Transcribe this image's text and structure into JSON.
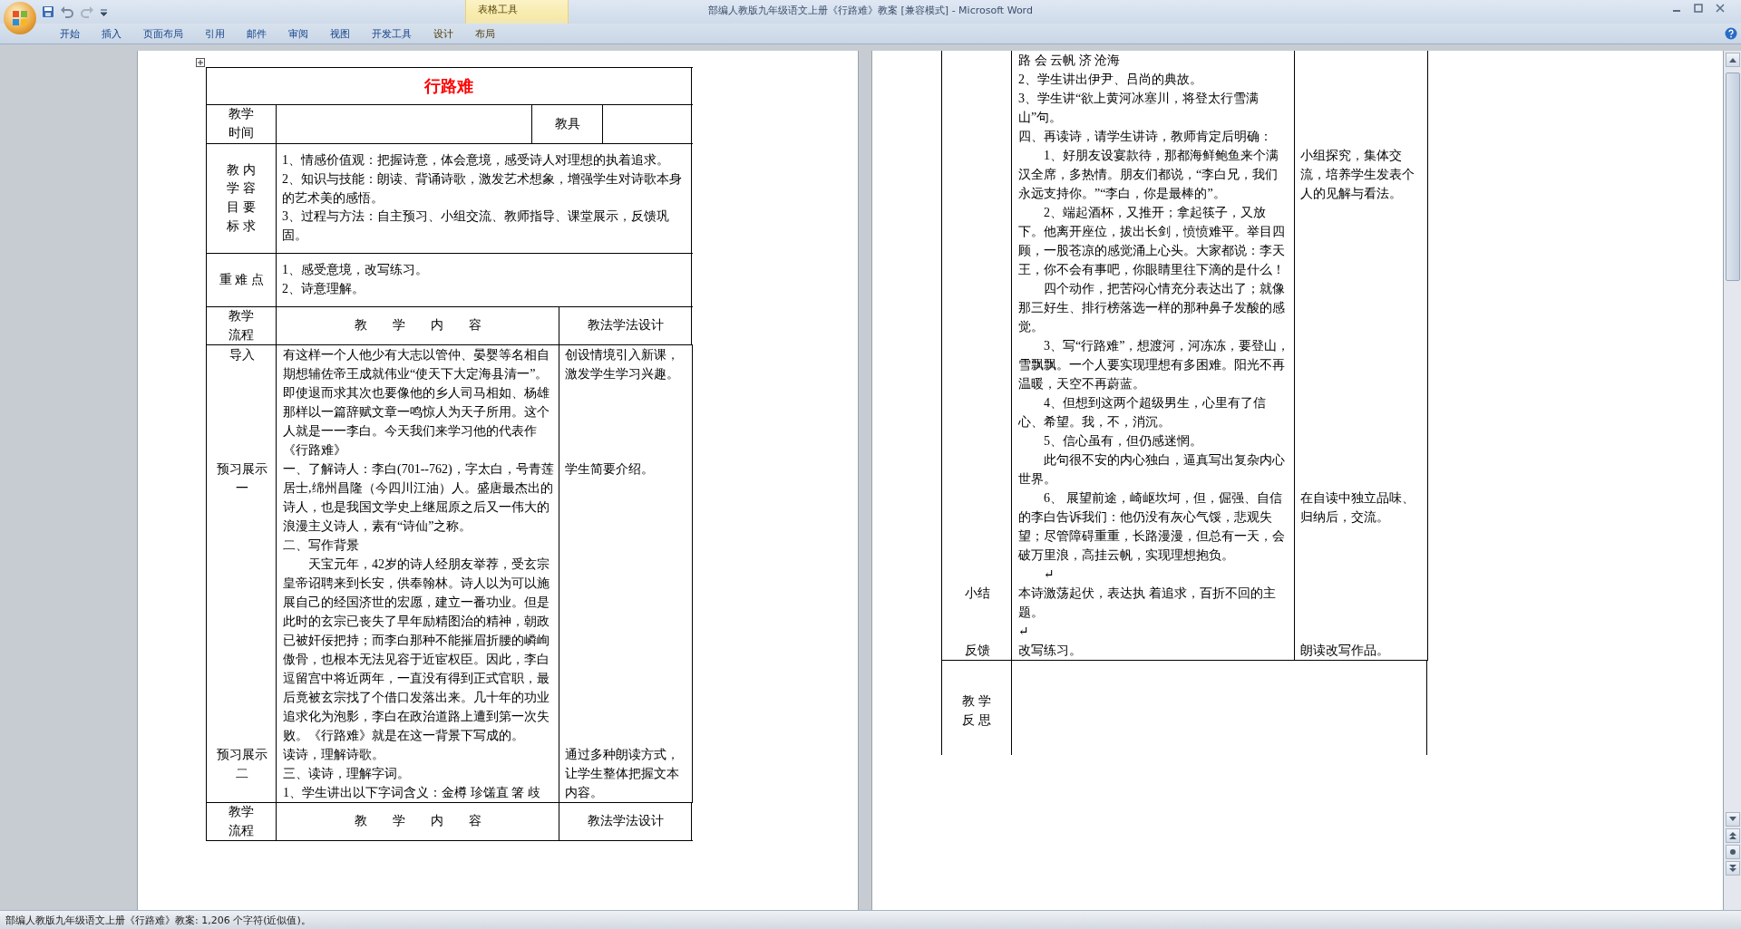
{
  "window": {
    "title": "部编人教版九年级语文上册《行路难》教案 [兼容模式] - Microsoft Word"
  },
  "ribbon": {
    "context_group": "表格工具",
    "tabs": [
      {
        "label": "开始",
        "selected": false,
        "contextual": false
      },
      {
        "label": "插入",
        "selected": false,
        "contextual": false
      },
      {
        "label": "页面布局",
        "selected": false,
        "contextual": false
      },
      {
        "label": "引用",
        "selected": false,
        "contextual": false
      },
      {
        "label": "邮件",
        "selected": false,
        "contextual": false
      },
      {
        "label": "审阅",
        "selected": false,
        "contextual": false
      },
      {
        "label": "视图",
        "selected": false,
        "contextual": false
      },
      {
        "label": "开发工具",
        "selected": false,
        "contextual": false
      },
      {
        "label": "设计",
        "selected": false,
        "contextual": true
      },
      {
        "label": "布局",
        "selected": false,
        "contextual": true
      }
    ]
  },
  "pages": [
    {
      "rows": [
        {
          "kind": "title",
          "text": "行路难"
        },
        {
          "kind": "time",
          "label": [
            "教学",
            "时间"
          ],
          "tool_label": "教具"
        },
        {
          "kind": "goals",
          "label": [
            "教 内",
            "学 容",
            "目 要",
            "标 求"
          ],
          "items": [
            "1、情感价值观：把握诗意，体会意境，感受诗人对理想的执着追求。",
            "2、知识与技能：朗读、背诵诗歌，激发艺术想象，增强学生对诗歌本身的艺术美的感悟。",
            "3、过程与方法：自主预习、小组交流、教师指导、课堂展示，反馈巩固。"
          ]
        },
        {
          "kind": "key",
          "label": [
            "重 难 点"
          ],
          "items": [
            "1、感受意境，改写练习。",
            "2、诗意理解。"
          ]
        },
        {
          "kind": "header",
          "label": [
            "教学",
            "流程"
          ],
          "content": "教　　学　　内　　容",
          "method": "教法学法设计"
        },
        {
          "kind": "process",
          "segments": [
            {
              "stage": "导入",
              "content": [
                {
                  "text": "有这样一个人他少有大志以管仲、晏婴等名相自期想辅佐帝王成就伟业“使天下大定海县清一”。即使退而求其次也要像他的乡人司马相如、杨雄那样以一篇辞赋文章一鸣惊人为天子所用。这个人就是一一李白。今天我们来学习他的代表作《行路难》",
                  "indent": false
                }
              ],
              "method": [
                "创设情境引入新课，激发学生学习兴趣。"
              ]
            },
            {
              "stage": "预习展示一",
              "content": [
                {
                  "text": "一、了解诗人：李白(701--762)，字太白，号青莲居士,绵州昌隆（今四川江油）人。盛唐最杰出的诗人，也是我国文学史上继屈原之后又一伟大的浪漫主义诗人，素有“诗仙”之称。",
                  "indent": false
                },
                {
                  "text": "二、写作背景",
                  "indent": false
                },
                {
                  "text": "天宝元年，42岁的诗人经朋友举荐，受玄宗皇帝诏聘来到长安，供奉翰林。诗人以为可以施展自己的经国济世的宏愿，建立一番功业。但是此时的玄宗已丧失了早年励精图治的精神，朝政已被奸佞把持；而李白那种不能摧眉折腰的嶙峋傲骨，也根本无法见容于近宦权臣。因此，李白逗留宫中将近两年，一直没有得到正式官职，最后竟被玄宗找了个借口发落出来。几十年的功业追求化为泡影，李白在政治道路上遭到第一次失败。《行路难》就是在这一背景下写成的。",
                  "indent": true
                }
              ],
              "method": [
                "学生简要介绍。"
              ]
            },
            {
              "stage": "预习展示二",
              "content": [
                {
                  "text": "读诗，理解诗歌。",
                  "indent": false
                },
                {
                  "text": "三、读诗，理解字词。",
                  "indent": false
                },
                {
                  "text": "1、学生讲出以下字词含义：金樽 珍馐直 箸 歧",
                  "indent": false
                }
              ],
              "method": [
                "通过多种朗读方式，让学生整体把握文本内容。"
              ]
            }
          ]
        },
        {
          "kind": "header",
          "label": [
            "教学",
            "流程"
          ],
          "content": "教　　学　　内　　容",
          "method": "教法学法设计"
        }
      ]
    },
    {
      "rows": [
        {
          "kind": "process",
          "segments": [
            {
              "content": [
                {
                  "text": "路 会 云帆 济 沧海",
                  "indent": false
                },
                {
                  "text": "2、学生讲出伊尹、吕尚的典故。",
                  "indent": false
                },
                {
                  "text": "3、学生讲“欲上黄河冰塞川，将登太行雪满山”句。",
                  "indent": false
                },
                {
                  "text": "四、再读诗，请学生讲诗，教师肯定后明确：",
                  "indent": false
                }
              ]
            },
            {
              "content": [
                {
                  "text": "1、好朋友设宴款待，那都海鲜鲍鱼来个满汉全席，多热情。朋友们都说，“李白兄，我们永远支持你。”“李白，你是最棒的”。",
                  "indent": true
                },
                {
                  "text": "2、端起酒杯，又推开；拿起筷子，又放下。他离开座位，拔出长剑，愤愤难平。举目四顾，一股苍凉的感觉涌上心头。大家都说：李天王，你不会有事吧，你眼睛里往下滴的是什么！",
                  "indent": true
                },
                {
                  "text": "四个动作，把苦闷心情充分表达出了；就像那三好生、排行榜落选一样的那种鼻子发酸的感觉。",
                  "indent": true
                },
                {
                  "text": "3、写“行路难”，想渡河，河冻冻，要登山，雪飘飘。一个人要实现理想有多困难。阳光不再温暖，天空不再蔚蓝。",
                  "indent": true
                },
                {
                  "text": "4、但想到这两个超级男生，心里有了信心、希望。我，不，消沉。",
                  "indent": true
                },
                {
                  "text": "5、信心虽有，但仍感迷惘。",
                  "indent": true
                },
                {
                  "text": "此句很不安的内心独白，逼真写出复杂内心世界。",
                  "indent": true
                }
              ],
              "method": [
                "小组探究，集体交流，培养学生发表个人的见解与看法。"
              ]
            },
            {
              "content": [
                {
                  "text": "6、 展望前途，崎岖坎坷，但，倔强、自信的李白告诉我们：他仍没有灰心气馁，悲观失望；尽管障碍重重，长路漫漫，但总有一天，会破万里浪，高挂云帆，实现理想抱负。",
                  "indent": true
                },
                {
                  "text": "↵",
                  "indent": true
                }
              ],
              "method": [
                "在自读中独立品味、归纳后，交流。"
              ]
            },
            {
              "stage": "小结",
              "content": [
                {
                  "text": "本诗激荡起伏，表达执 着追求，百折不回的主题。",
                  "indent": false
                },
                {
                  "text": "↵",
                  "indent": false
                }
              ]
            },
            {
              "stage": "反馈",
              "content": [
                {
                  "text": "改写练习。",
                  "indent": false
                }
              ],
              "method": [
                "朗读改写作品。"
              ]
            }
          ]
        },
        {
          "kind": "reflection",
          "label": [
            "教 学",
            "反 思"
          ]
        }
      ]
    }
  ],
  "status_bar": {
    "text": "部编人教版九年级语文上册《行路难》教案: 1,206 个字符(近似值)。"
  }
}
